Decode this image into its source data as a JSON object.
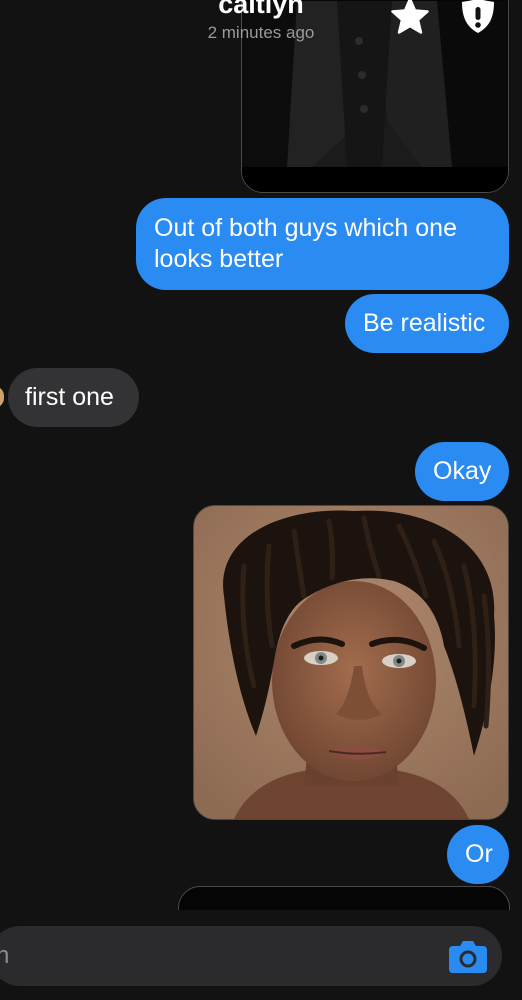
{
  "header": {
    "name": "caitlyn",
    "status": "2 minutes ago",
    "star_icon": "star-icon",
    "alert_icon": "alert-shield-icon"
  },
  "messages": [
    {
      "id": "m1",
      "type": "image",
      "direction": "outgoing",
      "description": "photo of man in black shirt"
    },
    {
      "id": "m2",
      "type": "text",
      "direction": "outgoing",
      "text": "Out of both guys which one looks better"
    },
    {
      "id": "m3",
      "type": "text",
      "direction": "outgoing",
      "text": "Be realistic"
    },
    {
      "id": "m4",
      "type": "text",
      "direction": "incoming",
      "text": "first one"
    },
    {
      "id": "m5",
      "type": "text",
      "direction": "outgoing",
      "text": "Okay"
    },
    {
      "id": "m6",
      "type": "image",
      "direction": "outgoing",
      "description": "portrait photo"
    },
    {
      "id": "m7",
      "type": "text",
      "direction": "outgoing",
      "text": "Or"
    },
    {
      "id": "m8",
      "type": "image",
      "direction": "outgoing",
      "description": "photo partially visible"
    }
  ],
  "composer": {
    "placeholder": "n",
    "camera_icon": "camera-icon"
  },
  "colors": {
    "background": "#121212",
    "outgoing_bubble": "#2a8bf2",
    "incoming_bubble": "#333335",
    "accent": "#2a8bf2"
  }
}
